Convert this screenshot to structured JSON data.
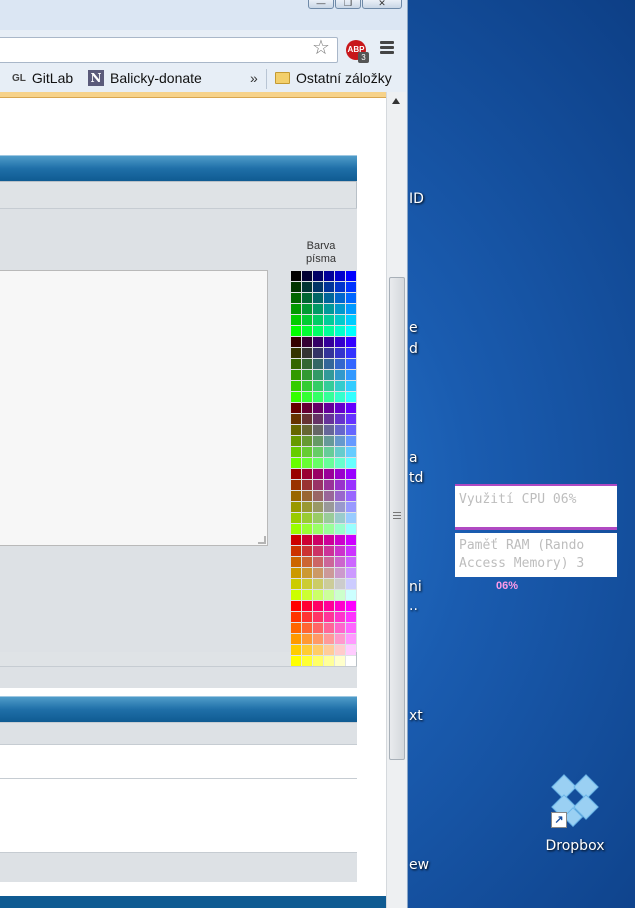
{
  "window": {
    "minimize_glyph": "—",
    "maximize_glyph": "❐",
    "close_glyph": "✕"
  },
  "toolbar": {
    "abp_label": "ABP",
    "abp_badge": "3"
  },
  "bookmarks": [
    {
      "icon": "GL",
      "label": "GitLab"
    },
    {
      "icon": "N",
      "label": "Balicky-donate"
    }
  ],
  "bookmarks_overflow": "»",
  "other_bookmarks": "Ostatní záložky",
  "editor": {
    "color_label": "Barva písma"
  },
  "palette_colors": [
    "#000000",
    "#000033",
    "#000066",
    "#000099",
    "#0000cc",
    "#0000ff",
    "#003300",
    "#003333",
    "#003366",
    "#003399",
    "#0033cc",
    "#0033ff",
    "#006600",
    "#006633",
    "#006666",
    "#006699",
    "#0066cc",
    "#0066ff",
    "#009900",
    "#009933",
    "#009966",
    "#009999",
    "#0099cc",
    "#0099ff",
    "#00cc00",
    "#00cc33",
    "#00cc66",
    "#00cc99",
    "#00cccc",
    "#00ccff",
    "#00ff00",
    "#00ff33",
    "#00ff66",
    "#00ff99",
    "#00ffcc",
    "#00ffff",
    "#330000",
    "#330033",
    "#330066",
    "#330099",
    "#3300cc",
    "#3300ff",
    "#333300",
    "#333333",
    "#333366",
    "#333399",
    "#3333cc",
    "#3333ff",
    "#336600",
    "#336633",
    "#336666",
    "#336699",
    "#3366cc",
    "#3366ff",
    "#339900",
    "#339933",
    "#339966",
    "#339999",
    "#3399cc",
    "#3399ff",
    "#33cc00",
    "#33cc33",
    "#33cc66",
    "#33cc99",
    "#33cccc",
    "#33ccff",
    "#33ff00",
    "#33ff33",
    "#33ff66",
    "#33ff99",
    "#33ffcc",
    "#33ffff",
    "#660000",
    "#660033",
    "#660066",
    "#660099",
    "#6600cc",
    "#6600ff",
    "#663300",
    "#663333",
    "#663366",
    "#663399",
    "#6633cc",
    "#6633ff",
    "#666600",
    "#666633",
    "#666666",
    "#666699",
    "#6666cc",
    "#6666ff",
    "#669900",
    "#669933",
    "#669966",
    "#669999",
    "#6699cc",
    "#6699ff",
    "#66cc00",
    "#66cc33",
    "#66cc66",
    "#66cc99",
    "#66cccc",
    "#66ccff",
    "#66ff00",
    "#66ff33",
    "#66ff66",
    "#66ff99",
    "#66ffcc",
    "#66ffff",
    "#990000",
    "#990033",
    "#990066",
    "#990099",
    "#9900cc",
    "#9900ff",
    "#993300",
    "#993333",
    "#993366",
    "#993399",
    "#9933cc",
    "#9933ff",
    "#996600",
    "#996633",
    "#996666",
    "#996699",
    "#9966cc",
    "#9966ff",
    "#999900",
    "#999933",
    "#999966",
    "#999999",
    "#9999cc",
    "#9999ff",
    "#99cc00",
    "#99cc33",
    "#99cc66",
    "#99cc99",
    "#99cccc",
    "#99ccff",
    "#99ff00",
    "#99ff33",
    "#99ff66",
    "#99ff99",
    "#99ffcc",
    "#99ffff",
    "#cc0000",
    "#cc0033",
    "#cc0066",
    "#cc0099",
    "#cc00cc",
    "#cc00ff",
    "#cc3300",
    "#cc3333",
    "#cc3366",
    "#cc3399",
    "#cc33cc",
    "#cc33ff",
    "#cc6600",
    "#cc6633",
    "#cc6666",
    "#cc6699",
    "#cc66cc",
    "#cc66ff",
    "#cc9900",
    "#cc9933",
    "#cc9966",
    "#cc9999",
    "#cc99cc",
    "#cc99ff",
    "#cccc00",
    "#cccc33",
    "#cccc66",
    "#cccc99",
    "#cccccc",
    "#ccccff",
    "#ccff00",
    "#ccff33",
    "#ccff66",
    "#ccff99",
    "#ccffcc",
    "#ccffff",
    "#ff0000",
    "#ff0033",
    "#ff0066",
    "#ff0099",
    "#ff00cc",
    "#ff00ff",
    "#ff3300",
    "#ff3333",
    "#ff3366",
    "#ff3399",
    "#ff33cc",
    "#ff33ff",
    "#ff6600",
    "#ff6633",
    "#ff6666",
    "#ff6699",
    "#ff66cc",
    "#ff66ff",
    "#ff9900",
    "#ff9933",
    "#ff9966",
    "#ff9999",
    "#ff99cc",
    "#ff99ff",
    "#ffcc00",
    "#ffcc33",
    "#ffcc66",
    "#ffcc99",
    "#ffcccc",
    "#ffccff",
    "#ffff00",
    "#ffff33",
    "#ffff66",
    "#ffff99",
    "#ffffcc",
    "#ffffff"
  ],
  "desktop_fragments": [
    {
      "text": "ID"
    },
    {
      "text": "e"
    },
    {
      "text": "d"
    },
    {
      "text": "a"
    },
    {
      "text": "td"
    },
    {
      "text": "ni"
    },
    {
      "text": ".."
    },
    {
      "text": "xt"
    },
    {
      "text": "ew"
    }
  ],
  "gadgets": {
    "cpu_text": "Využití CPU 06%",
    "ram_line1": "Paměť RAM (Rando",
    "ram_line2": "Access Memory) 3",
    "percent": "06%"
  },
  "dropbox": {
    "label": "Dropbox",
    "shortcut_glyph": "↗"
  }
}
